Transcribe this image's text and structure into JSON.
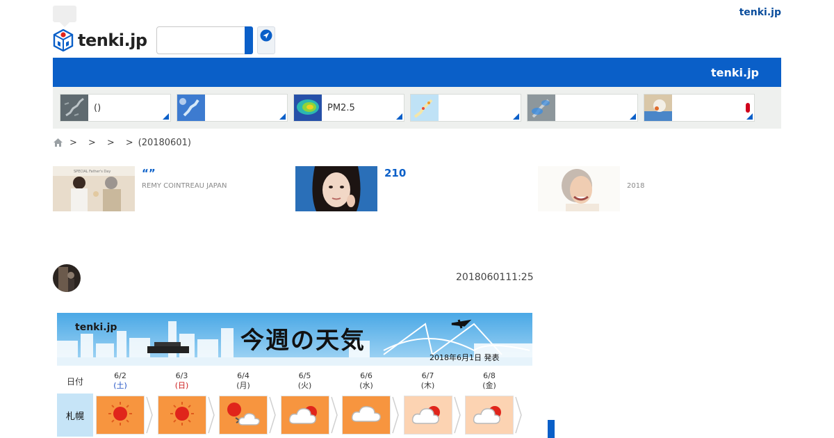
{
  "header": {
    "top_link": "tenki.jp",
    "logo_text": "tenki.jp",
    "search_placeholder": "",
    "locate_icon": "location-arrow-icon"
  },
  "bluebar": {
    "title": "tenki.jp"
  },
  "map_tiles": [
    {
      "label": "()",
      "icon": "japan-map-icon"
    },
    {
      "label": "",
      "icon": "satellite-map-icon"
    },
    {
      "label": "PM2.5",
      "icon": "pm25-map-icon"
    },
    {
      "label": "",
      "icon": "warning-map-icon"
    },
    {
      "label": "",
      "icon": "rain-radar-icon"
    },
    {
      "label": "",
      "icon": "heatstroke-icon"
    }
  ],
  "breadcrumb": {
    "home_icon": "home-icon",
    "separators": [
      ">",
      ">",
      ">",
      ">"
    ],
    "current": "(20180601)"
  },
  "promos": [
    {
      "title": "“”",
      "subtitle": "REMY COINTREAU JAPAN",
      "image_text": "SPECIAL Father's Day"
    },
    {
      "title": "210",
      "subtitle": ""
    },
    {
      "title": "",
      "subtitle": "2018"
    }
  ],
  "article": {
    "datetime": "2018060111:25"
  },
  "weather_image": {
    "logo": "tenki.jp",
    "title": "今週の天気",
    "issued": "2018年6月1日 発表",
    "day_header": "日付",
    "city": "札幌",
    "days": [
      {
        "date": "6/2",
        "weekday": "(土)",
        "kind": "sat",
        "weather": "sunny",
        "intensity": "strong"
      },
      {
        "date": "6/3",
        "weekday": "(日)",
        "kind": "sun",
        "weather": "sunny",
        "intensity": "strong"
      },
      {
        "date": "6/4",
        "weekday": "(月)",
        "kind": "",
        "weather": "sunny-then-cloudy",
        "intensity": "strong"
      },
      {
        "date": "6/5",
        "weekday": "(火)",
        "kind": "",
        "weather": "cloudy-sometimes-sunny",
        "intensity": "strong"
      },
      {
        "date": "6/6",
        "weekday": "(水)",
        "kind": "",
        "weather": "cloudy",
        "intensity": "strong"
      },
      {
        "date": "6/7",
        "weekday": "(木)",
        "kind": "",
        "weather": "cloudy-sometimes-sunny",
        "intensity": "pale"
      },
      {
        "date": "6/8",
        "weekday": "(金)",
        "kind": "",
        "weather": "cloudy-sometimes-sunny",
        "intensity": "pale"
      }
    ]
  },
  "colors": {
    "brand_blue": "#0a5fc8",
    "link_blue": "#0a4d9c",
    "sun_orange": "#f7953f",
    "sun_pale": "#fcd3b2"
  }
}
